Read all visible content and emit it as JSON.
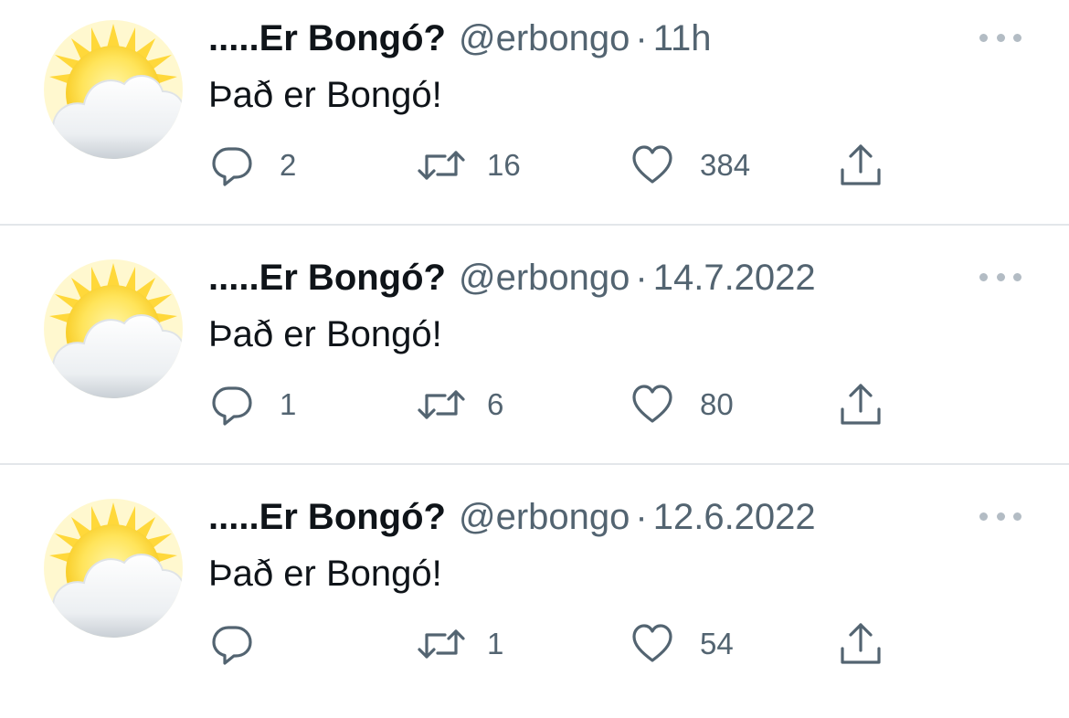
{
  "colors": {
    "text": "#0f1419",
    "secondary": "#536471",
    "divider": "#e3e6ea",
    "more_dots": "#b3bcc4"
  },
  "avatar_icon": "sun-behind-cloud-emoji",
  "tweets": [
    {
      "name": ".....Er Bongó?",
      "handle": "@erbongo",
      "separator": "·",
      "time": "11h",
      "text": "Það er Bongó!",
      "replies": "2",
      "retweets": "16",
      "likes": "384"
    },
    {
      "name": ".....Er Bongó?",
      "handle": "@erbongo",
      "separator": "·",
      "time": "14.7.2022",
      "text": "Það er Bongó!",
      "replies": "1",
      "retweets": "6",
      "likes": "80"
    },
    {
      "name": ".....Er Bongó?",
      "handle": "@erbongo",
      "separator": "·",
      "time": "12.6.2022",
      "text": "Það er Bongó!",
      "replies": "",
      "retweets": "1",
      "likes": "54"
    }
  ]
}
